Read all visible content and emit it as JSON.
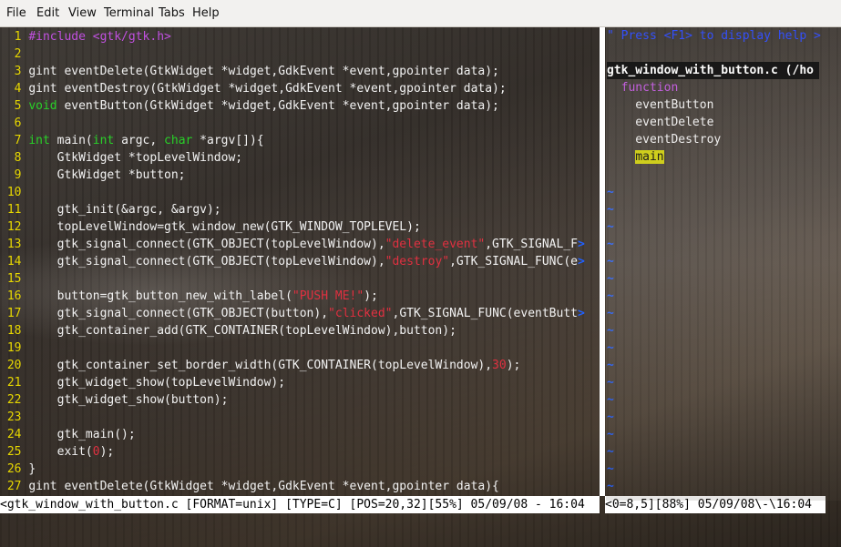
{
  "menu": [
    "File",
    "Edit",
    "View",
    "Terminal",
    "Tabs",
    "Help"
  ],
  "code_lines": [
    {
      "n": "1",
      "parts": [
        {
          "t": "#include <gtk/gtk.h>",
          "c": "pp"
        }
      ]
    },
    {
      "n": "2",
      "parts": []
    },
    {
      "n": "3",
      "parts": [
        {
          "t": "gint eventDelete(GtkWidget *widget,GdkEvent *event,gpointer data);"
        }
      ]
    },
    {
      "n": "4",
      "parts": [
        {
          "t": "gint eventDestroy(GtkWidget *widget,GdkEvent *event,gpointer data);"
        }
      ]
    },
    {
      "n": "5",
      "parts": [
        {
          "t": "void",
          "c": "kw"
        },
        {
          "t": " eventButton(GtkWidget *widget,GdkEvent *event,gpointer data);"
        }
      ]
    },
    {
      "n": "6",
      "parts": []
    },
    {
      "n": "7",
      "parts": [
        {
          "t": "int",
          "c": "kw"
        },
        {
          "t": " main("
        },
        {
          "t": "int",
          "c": "kw"
        },
        {
          "t": " argc, "
        },
        {
          "t": "char",
          "c": "kw"
        },
        {
          "t": " *argv[]){"
        }
      ]
    },
    {
      "n": "8",
      "parts": [
        {
          "t": "    GtkWidget *topLevelWindow;"
        }
      ]
    },
    {
      "n": "9",
      "parts": [
        {
          "t": "    GtkWidget *button;"
        }
      ]
    },
    {
      "n": "10",
      "parts": []
    },
    {
      "n": "11",
      "parts": [
        {
          "t": "    gtk_init(&argc, &argv);"
        }
      ]
    },
    {
      "n": "12",
      "parts": [
        {
          "t": "    topLevelWindow=gtk_window_new(GTK_WINDOW_TOPLEVEL);"
        }
      ]
    },
    {
      "n": "13",
      "parts": [
        {
          "t": "    gtk_signal_connect(GTK_OBJECT(topLevelWindow),"
        },
        {
          "t": "\"delete_event\"",
          "c": "str"
        },
        {
          "t": ",GTK_SIGNAL_F"
        },
        {
          "t": ">",
          "c": "gt"
        }
      ]
    },
    {
      "n": "14",
      "parts": [
        {
          "t": "    gtk_signal_connect(GTK_OBJECT(topLevelWindow),"
        },
        {
          "t": "\"destroy\"",
          "c": "str"
        },
        {
          "t": ",GTK_SIGNAL_FUNC(e"
        },
        {
          "t": ">",
          "c": "gt"
        }
      ]
    },
    {
      "n": "15",
      "parts": []
    },
    {
      "n": "16",
      "parts": [
        {
          "t": "    button=gtk_button_new_with_label("
        },
        {
          "t": "\"PUSH ME!\"",
          "c": "str"
        },
        {
          "t": ");"
        }
      ]
    },
    {
      "n": "17",
      "parts": [
        {
          "t": "    gtk_signal_connect(GTK_OBJECT(button),"
        },
        {
          "t": "\"clicked\"",
          "c": "str"
        },
        {
          "t": ",GTK_SIGNAL_FUNC(eventButt"
        },
        {
          "t": ">",
          "c": "gt"
        }
      ]
    },
    {
      "n": "18",
      "parts": [
        {
          "t": "    gtk_container_add(GTK_CONTAINER(topLevelWindow),button);"
        }
      ]
    },
    {
      "n": "19",
      "parts": []
    },
    {
      "n": "20",
      "parts": [
        {
          "t": "    gtk_container_set_border_width(GTK_CONTAINER(topLevelWindow),"
        },
        {
          "t": "30",
          "c": "str"
        },
        {
          "t": ");"
        }
      ]
    },
    {
      "n": "21",
      "parts": [
        {
          "t": "    gtk_widget_show(topLevelWindow);"
        }
      ]
    },
    {
      "n": "22",
      "parts": [
        {
          "t": "    gtk_widget_show(button);"
        }
      ]
    },
    {
      "n": "23",
      "parts": []
    },
    {
      "n": "24",
      "parts": [
        {
          "t": "    gtk_main();"
        }
      ]
    },
    {
      "n": "25",
      "parts": [
        {
          "t": "    exit("
        },
        {
          "t": "0",
          "c": "str"
        },
        {
          "t": ");"
        }
      ]
    },
    {
      "n": "26",
      "parts": [
        {
          "t": "}"
        }
      ]
    },
    {
      "n": "27",
      "parts": [
        {
          "t": "gint eventDelete(GtkWidget *widget,GdkEvent *event,gpointer data){"
        }
      ]
    }
  ],
  "taglist": {
    "help": "\" Press <F1> to display help >",
    "file": "gtk_window_with_button.c (/ho",
    "kind": "  function",
    "functions": [
      "    eventButton",
      "    eventDelete",
      "    eventDestroy"
    ],
    "selected": "main",
    "tilde": "~"
  },
  "status": {
    "left": "<gtk_window_with_button.c [FORMAT=unix] [TYPE=C] [POS=20,32][55%] 05/09/08 - 16:04",
    "right": "<0=8,5][88%] 05/09/08\\-\\16:04"
  },
  "colors": {
    "line_number": "#e8d800",
    "keyword": "#28d028",
    "preprocessor": "#c050e0",
    "string": "#e03040",
    "tilde": "#1e5cff",
    "selected_tag_bg": "#cfcf00"
  }
}
